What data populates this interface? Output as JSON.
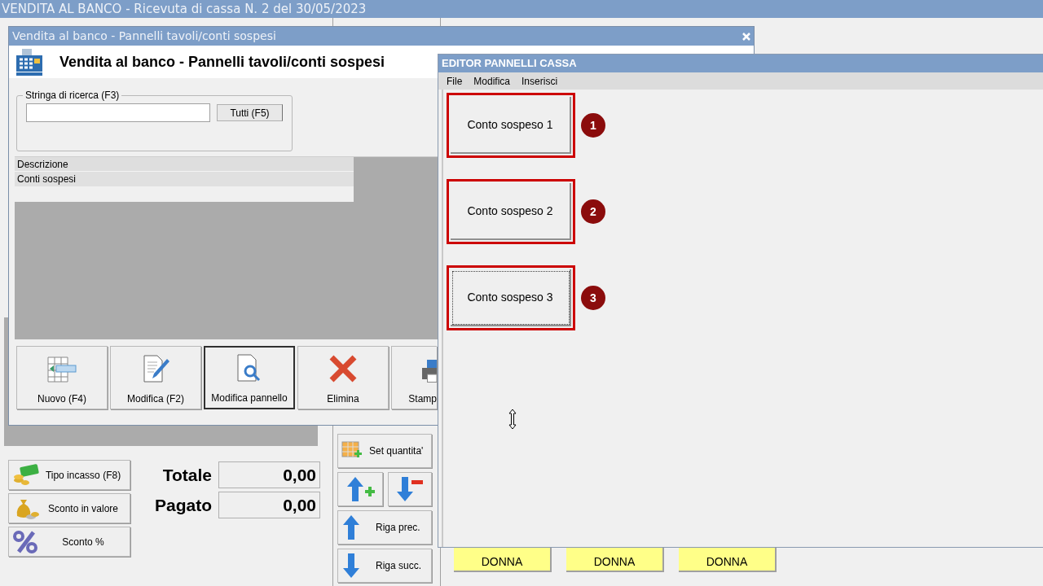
{
  "app": {
    "title": "VENDITA AL BANCO - Ricevuta di cassa N. 2 del 30/05/2023"
  },
  "side_buttons": [
    {
      "kind": "cash",
      "label": "Tipo incasso (F8)"
    },
    {
      "kind": "bag",
      "label": "Sconto in valore"
    },
    {
      "kind": "percent",
      "label": "Sconto %"
    }
  ],
  "totals": [
    {
      "label": "Totale",
      "value": "0,00"
    },
    {
      "label": "Pagato",
      "value": "0,00"
    }
  ],
  "row_buttons": [
    {
      "kind": "set_quantity",
      "label": "Set quantita'"
    },
    {
      "kind": "add_row"
    },
    {
      "kind": "remove_row"
    },
    {
      "kind": "prev",
      "label": "Riga prec."
    },
    {
      "kind": "next",
      "label": "Riga succ."
    }
  ],
  "panel_buttons": [
    "DONNA",
    "DONNA",
    "DONNA"
  ],
  "panels_window": {
    "title": "Vendita al banco - Pannelli tavoli/conti sospesi",
    "heading": "Vendita al banco - Pannelli tavoli/conti sospesi",
    "search": {
      "label": "Stringa di ricerca (F3)",
      "button": "Tutti (F5)"
    },
    "table": {
      "columns": [
        "Descrizione"
      ],
      "rows": [
        [
          "Conti sospesi"
        ]
      ]
    },
    "toolbar": [
      {
        "kind": "new",
        "label": "Nuovo (F4)",
        "focused": false
      },
      {
        "kind": "edit",
        "label": "Modifica (F2)",
        "focused": false
      },
      {
        "kind": "edit_panel",
        "label": "Modifica pannello",
        "focused": true
      },
      {
        "kind": "delete",
        "label": "Elimina",
        "focused": false
      },
      {
        "kind": "print",
        "label": "Stamp",
        "focused": false
      }
    ]
  },
  "editor": {
    "title": "EDITOR PANNELLI CASSA",
    "menu": [
      "File",
      "Modifica",
      "Inserisci"
    ],
    "buttons": [
      {
        "label": "Conto sospeso 1",
        "badge": "1",
        "focused": false
      },
      {
        "label": "Conto sospeso 2",
        "badge": "2",
        "focused": false
      },
      {
        "label": "Conto sospeso 3",
        "badge": "3",
        "focused": true
      }
    ]
  }
}
